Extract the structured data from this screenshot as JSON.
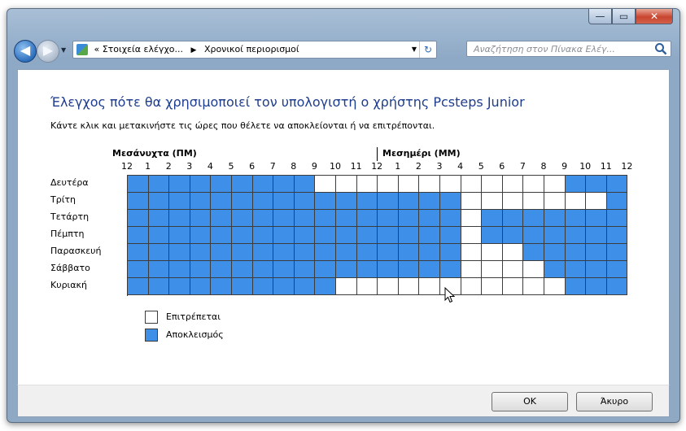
{
  "window": {
    "controls": {
      "minimize": "—",
      "maximize": "▭",
      "close": "✕"
    }
  },
  "navbar": {
    "address": {
      "prefix": "«",
      "crumb1": "Στοιχεία ελέγχο...",
      "separator": "▶",
      "crumb2": "Χρονικοί περιορισμοί"
    },
    "search_placeholder": "Αναζήτηση στον Πίνακα Ελέγ..."
  },
  "main": {
    "title": "Έλεγχος πότε θα χρησιμοποιεί τον υπολογιστή ο χρήστης Pcsteps Junior",
    "instruction": "Κάντε κλικ και μετακινήστε τις ώρες που θέλετε να αποκλείονται ή να επιτρέπονται.",
    "midnight_label": "Μεσάνυχτα (ΠΜ)",
    "noon_label": "Μεσημέρι (ΜΜ)",
    "hour_labels": [
      "12",
      "1",
      "2",
      "3",
      "4",
      "5",
      "6",
      "7",
      "8",
      "9",
      "10",
      "11",
      "12",
      "1",
      "2",
      "3",
      "4",
      "5",
      "6",
      "7",
      "8",
      "9",
      "10",
      "11",
      "12"
    ],
    "days": [
      {
        "name": "Δευτέρα",
        "hours": "BBBBBBBBBAAAAAAAAAAAABBBBB"
      },
      {
        "name": "Τρίτη",
        "hours": "BBBBBBBBBBBBBBBBAAAAAAABBBBB"
      },
      {
        "name": "Τετάρτη",
        "hours": "BBBBBBBBBBBBBBBBABBBBBBBBBBB"
      },
      {
        "name": "Πέμπτη",
        "hours": "BBBBBBBBBBBBBBBBABBBBBBBBBBB"
      },
      {
        "name": "Παρασκευή",
        "hours": "BBBBBBBBBBBBBBBBAAABBBBBBBBB"
      },
      {
        "name": "Σάββατο",
        "hours": "BBBBBBBBBBBBBBBBAAAABBBBBBBB"
      },
      {
        "name": "Κυριακή",
        "hours": "BBBBBBBBBBAAAAAAAAAAABBBBBBB"
      }
    ],
    "legend": {
      "allowed": "Επιτρέπεται",
      "blocked": "Αποκλεισμός"
    },
    "colors": {
      "blocked": "#3d8fe8",
      "allowed": "#ffffff"
    }
  },
  "footer": {
    "ok": "OK",
    "cancel": "Άκυρο"
  }
}
